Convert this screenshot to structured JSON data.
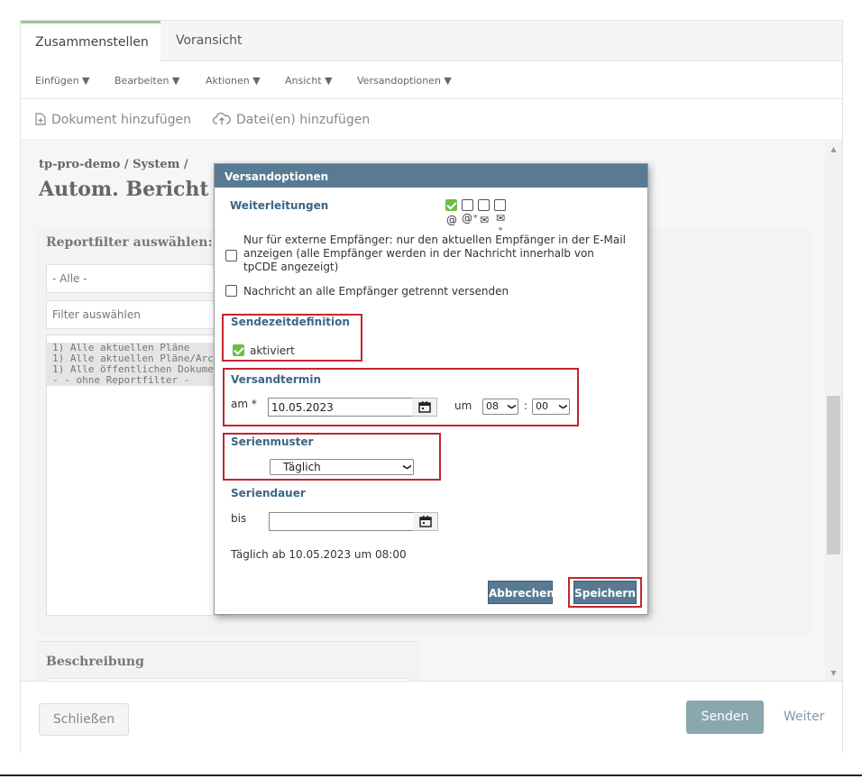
{
  "tabs": [
    {
      "label": "Zusammenstellen",
      "active": true
    },
    {
      "label": "Voransicht",
      "active": false
    }
  ],
  "menu": [
    {
      "label": "Einfügen ▼"
    },
    {
      "label": "Bearbeiten ▼"
    },
    {
      "label": "Aktionen ▼"
    },
    {
      "label": "Ansicht ▼"
    },
    {
      "label": "Versandoptionen ▼"
    }
  ],
  "actions": {
    "add_document": "Dokument hinzufügen",
    "add_files": "Datei(en) hinzufügen"
  },
  "content": {
    "breadcrumb": "tp-pro-demo / System /",
    "title": "Autom. Bericht",
    "report_filter": {
      "heading": "Reportfilter auswählen:",
      "dropdown_value": "- Alle -",
      "filter_placeholder": "Filter auswählen",
      "items": [
        "1) Alle aktuellen Pläne",
        "1) Alle aktuellen Pläne/Architel",
        "1) Alle öffentlichen Dokumente",
        "- - ohne Reportfilter -"
      ]
    },
    "description_heading": "Beschreibung"
  },
  "footer": {
    "close_label": "Schließen",
    "send_label": "Senden",
    "next_label": "Weiter"
  },
  "modal": {
    "title": "Versandoptionen",
    "forwarding": {
      "heading": "Weiterleitungen",
      "icons": [
        "@",
        "@⁺",
        "✉",
        "✉⁺"
      ],
      "checkboxes": [
        true,
        false,
        false,
        false
      ]
    },
    "external_only_label": "Nur für externe Empfänger: nur den aktuellen Empfänger in der E-Mail anzeigen (alle Empfänger werden in der Nachricht innerhalb von tpCDE angezeigt)",
    "separate_label": "Nachricht an alle Empfänger getrennt versenden",
    "send_time": {
      "heading": "Sendezeitdefinition",
      "activated_label": "aktiviert",
      "activated": true
    },
    "schedule": {
      "heading": "Versandtermin",
      "date_label": "am *",
      "date_value": "10.05.2023",
      "time_label": "um",
      "hour": "08",
      "minute": "00",
      "colon": ":"
    },
    "series": {
      "heading": "Serienmuster",
      "value": "Täglich"
    },
    "duration": {
      "heading": "Seriendauer",
      "until_label": "bis",
      "until_value": ""
    },
    "summary": "Täglich ab 10.05.2023 um 08:00",
    "cancel_label": "Abbrechen",
    "save_label": "Speichern"
  }
}
